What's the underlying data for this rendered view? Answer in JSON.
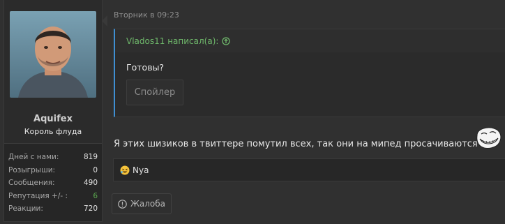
{
  "author": {
    "name": "Aquifex",
    "title": "Король флуда",
    "avatar_icon": "user-avatar-photo",
    "stats": [
      {
        "label": "Дней с нами:",
        "value": "819",
        "color": "#e0e0e0"
      },
      {
        "label": "Розыгрыши:",
        "value": "0",
        "color": "#e0e0e0"
      },
      {
        "label": "Сообщения:",
        "value": "490",
        "color": "#e0e0e0"
      },
      {
        "label": "Репутация +/- :",
        "value": "6",
        "color": "#5aa64e"
      },
      {
        "label": "Реакции:",
        "value": "720",
        "color": "#e0e0e0"
      }
    ]
  },
  "post": {
    "timestamp": "Вторник в 09:23",
    "quote": {
      "author_line": "Vlados11 написал(а):",
      "text": "Готовы?",
      "spoiler_label": "Спойлер",
      "accent_color": "#3f8fd2"
    },
    "message": "Я этих шизиков в твиттере помутил всех, так они на мипед просачиваются",
    "emoji_icon": "troll-face-icon",
    "reaction": {
      "icon": "laughing-emoji-icon",
      "label": "Nya"
    },
    "report_label": "Жалоба"
  }
}
